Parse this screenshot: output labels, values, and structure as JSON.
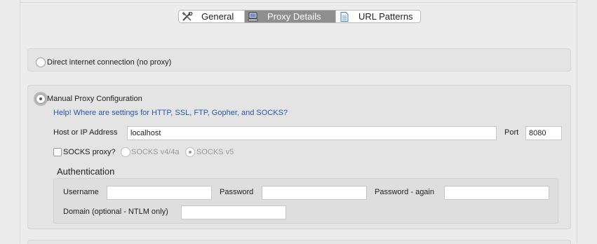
{
  "tabs": [
    {
      "label": "General",
      "icon": "tools-icon",
      "active": false
    },
    {
      "label": "Proxy Details",
      "icon": "computer-icon",
      "active": true
    },
    {
      "label": "URL Patterns",
      "icon": "document-icon",
      "active": false
    }
  ],
  "direct": {
    "label": "Direct internet connection (no proxy)",
    "selected": false
  },
  "manual": {
    "label": "Manual Proxy Configuration",
    "selected": true,
    "help_link": "Help! Where are settings for HTTP, SSL, FTP, Gopher, and SOCKS?",
    "host_label": "Host or IP Address",
    "host_value": "localhost",
    "port_label": "Port",
    "port_value": "8080",
    "socks_label": "SOCKS proxy?",
    "socks_checked": false,
    "socks_v4_label": "SOCKS v4/4a",
    "socks_v5_label": "SOCKS v5",
    "socks_version_selected": "SOCKS v5"
  },
  "auth": {
    "title": "Authentication",
    "username_label": "Username",
    "username_value": "",
    "password_label": "Password",
    "password_value": "",
    "password_again_label": "Password - again",
    "password_again_value": "",
    "domain_label": "Domain (optional - NTLM only)",
    "domain_value": ""
  },
  "colors": {
    "link": "#2a57b0",
    "active_tab": "#8e8e8e",
    "panel": "#e4e4e4",
    "background": "#ececec"
  }
}
